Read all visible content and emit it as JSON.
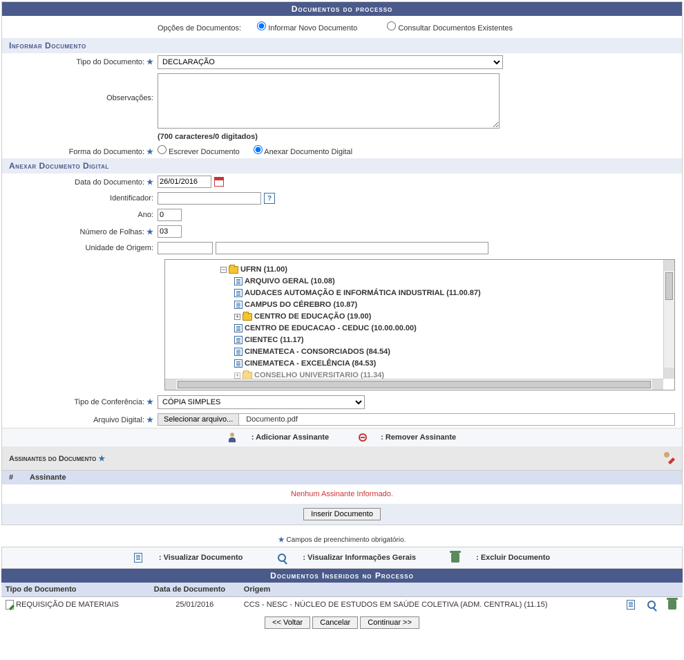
{
  "header": {
    "title": "Documentos do processo"
  },
  "options": {
    "label": "Opções de Documentos:",
    "opt1": "Informar Novo Documento",
    "opt2": "Consultar Documentos Existentes"
  },
  "section_inform": "Informar Documento",
  "doc_type": {
    "label": "Tipo do Documento:",
    "value": "DECLARAÇÃO"
  },
  "obs": {
    "label": "Observações:",
    "counter": "(700 caracteres/0 digitados)"
  },
  "doc_form": {
    "label": "Forma do Documento:",
    "opt_write": "Escrever Documento",
    "opt_attach": "Anexar Documento Digital"
  },
  "section_attach": "Anexar Documento Digital",
  "date": {
    "label": "Data do Documento:",
    "value": "26/01/2016"
  },
  "ident": {
    "label": "Identificador:"
  },
  "year": {
    "label": "Ano:",
    "value": "0"
  },
  "pages": {
    "label": "Número de Folhas:",
    "value": "03"
  },
  "origin": {
    "label": "Unidade de Origem:"
  },
  "tree": {
    "root": "UFRN (11.00)",
    "items": [
      "ARQUIVO GERAL (10.08)",
      "AUDACES AUTOMAÇÃO E INFORMÁTICA INDUSTRIAL (11.00.87)",
      "CAMPUS DO CÉREBRO (10.87)",
      "CENTRO DE EDUCAÇÃO (19.00)",
      "CENTRO DE EDUCACAO - CEDUC (10.00.00.00)",
      "CIENTEC (11.17)",
      "CINEMATECA - CONSORCIADOS (84.54)",
      "CINEMATECA - EXCELÊNCIA (84.53)",
      "CONSELHO UNIVERSITARIO (11.34)"
    ]
  },
  "conf": {
    "label": "Tipo de Conferência:",
    "value": "CÓPIA SIMPLES"
  },
  "file": {
    "label": "Arquivo Digital:",
    "btn": "Selecionar arquivo...",
    "name": "Documento.pdf"
  },
  "signers": {
    "add": ": Adicionar Assinante",
    "remove": ": Remover Assinante",
    "header": "Assinantes do Documento",
    "col_hash": "#",
    "col_name": "Assinante",
    "empty": "Nenhum Assinante Informado."
  },
  "insert_btn": "Inserir Documento",
  "req_note": "Campos de preenchimento obrigatório.",
  "legend": {
    "view": ": Visualizar Documento",
    "info": ": Visualizar Informações Gerais",
    "del": ": Excluir Documento"
  },
  "inserted": {
    "title": "Documentos Inseridos no Processo",
    "col_type": "Tipo de Documento",
    "col_date": "Data de Documento",
    "col_origin": "Origem",
    "row": {
      "type": "REQUISIÇÃO DE MATERIAIS",
      "date": "25/01/2016",
      "origin": "CCS - NESC - NÚCLEO DE ESTUDOS EM SAÚDE COLETIVA (ADM. CENTRAL) (11.15)"
    }
  },
  "footer": {
    "back": "<< Voltar",
    "cancel": "Cancelar",
    "cont": "Continuar >>"
  }
}
